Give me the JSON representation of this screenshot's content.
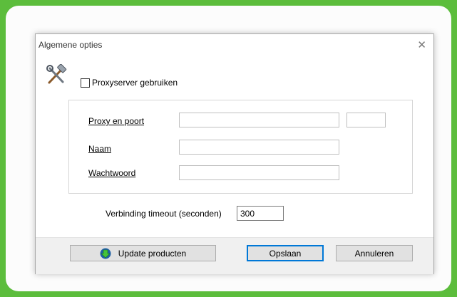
{
  "dialog": {
    "title": "Algemene opties",
    "close_glyph": "✕",
    "icon": "tools-icon"
  },
  "proxy": {
    "checkbox_label": "Proxyserver gebruiken",
    "checked": false
  },
  "fields": {
    "proxy_port_label": "Proxy en poort",
    "proxy_value": "",
    "port_value": "",
    "name_label": "Naam",
    "name_value": "",
    "password_label": "Wachtwoord",
    "password_value": ""
  },
  "timeout": {
    "label": "Verbinding timeout (seconden)",
    "value": "300"
  },
  "buttons": {
    "update": "Update producten",
    "update_icon": "green-down-arrow-icon",
    "save": "Opslaan",
    "cancel": "Annuleren"
  },
  "colors": {
    "frame_green": "#5cbd3c",
    "default_button_border": "#0078d7"
  }
}
